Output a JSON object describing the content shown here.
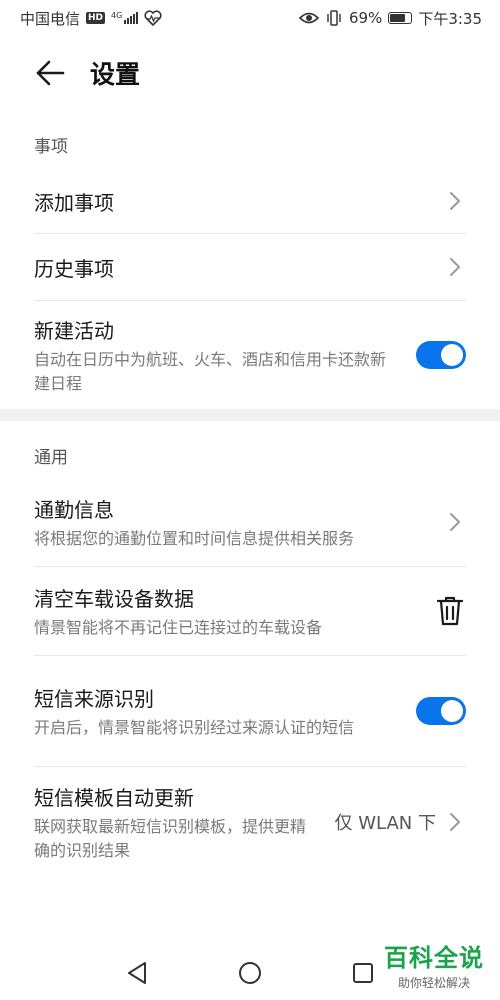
{
  "status_bar": {
    "carrier": "中国电信",
    "hd": "HD",
    "network": "4G",
    "battery": "69%",
    "time": "下午3:35"
  },
  "header": {
    "title": "设置"
  },
  "sections": [
    {
      "title": "事项",
      "rows": [
        {
          "title": "添加事项",
          "control": "chevron"
        },
        {
          "title": "历史事项",
          "control": "chevron"
        },
        {
          "title": "新建活动",
          "subtitle": "自动在日历中为航班、火车、酒店和信用卡还款新建日程",
          "control": "toggle",
          "toggle_on": true
        }
      ]
    },
    {
      "title": "通用",
      "rows": [
        {
          "title": "通勤信息",
          "subtitle": "将根据您的通勤位置和时间信息提供相关服务",
          "control": "chevron"
        },
        {
          "title": "清空车载设备数据",
          "subtitle": "情景智能将不再记住已连接过的车载设备",
          "control": "trash-icon"
        },
        {
          "title": "短信来源识别",
          "subtitle": "开启后，情景智能将识别经过来源认证的短信",
          "control": "toggle",
          "toggle_on": true
        },
        {
          "title": "短信模板自动更新",
          "subtitle": "联网获取最新短信识别模板，提供更精确的识别结果",
          "control": "value-chevron",
          "value": "仅 WLAN 下"
        }
      ]
    }
  ],
  "colors": {
    "accent": "#0a74ec",
    "watermark": "#1aa34a"
  },
  "watermark": {
    "main": "百科全说",
    "sub": "助你轻松解决"
  }
}
